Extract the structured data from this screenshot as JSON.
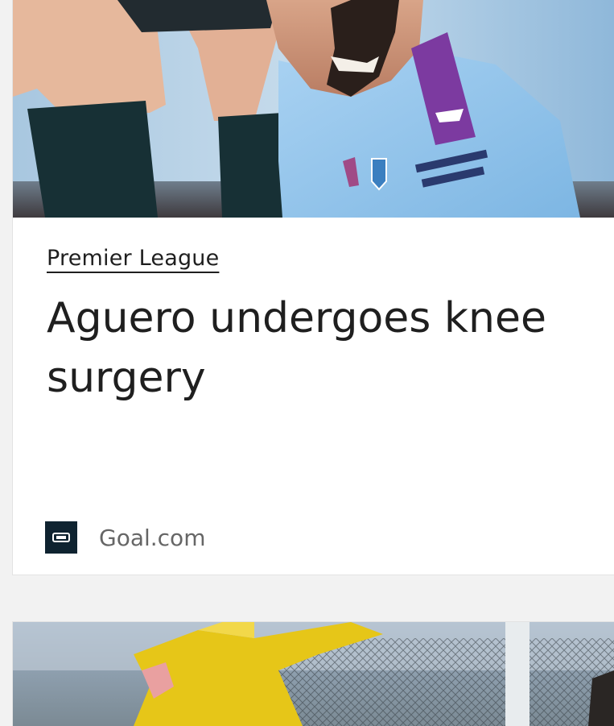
{
  "cards": [
    {
      "image_alt": "Sergio Aguero in Manchester City kit",
      "category": "Premier League",
      "headline": "Aguero undergoes knee surgery",
      "source": {
        "name": "Goal.com",
        "logo_icon": "goal-logo-icon"
      }
    },
    {
      "image_alt": "Goalkeeper in yellow kit diving"
    }
  ],
  "colors": {
    "page_background": "#f2f2f2",
    "card_background": "#ffffff",
    "headline_text": "#1f1f1f",
    "source_text": "#666666",
    "source_logo_bg": "#0f2330",
    "city_sky_blue": "#8ec3ea",
    "sponsor_purple": "#7c3aa0",
    "keeper_yellow": "#e6c618"
  }
}
